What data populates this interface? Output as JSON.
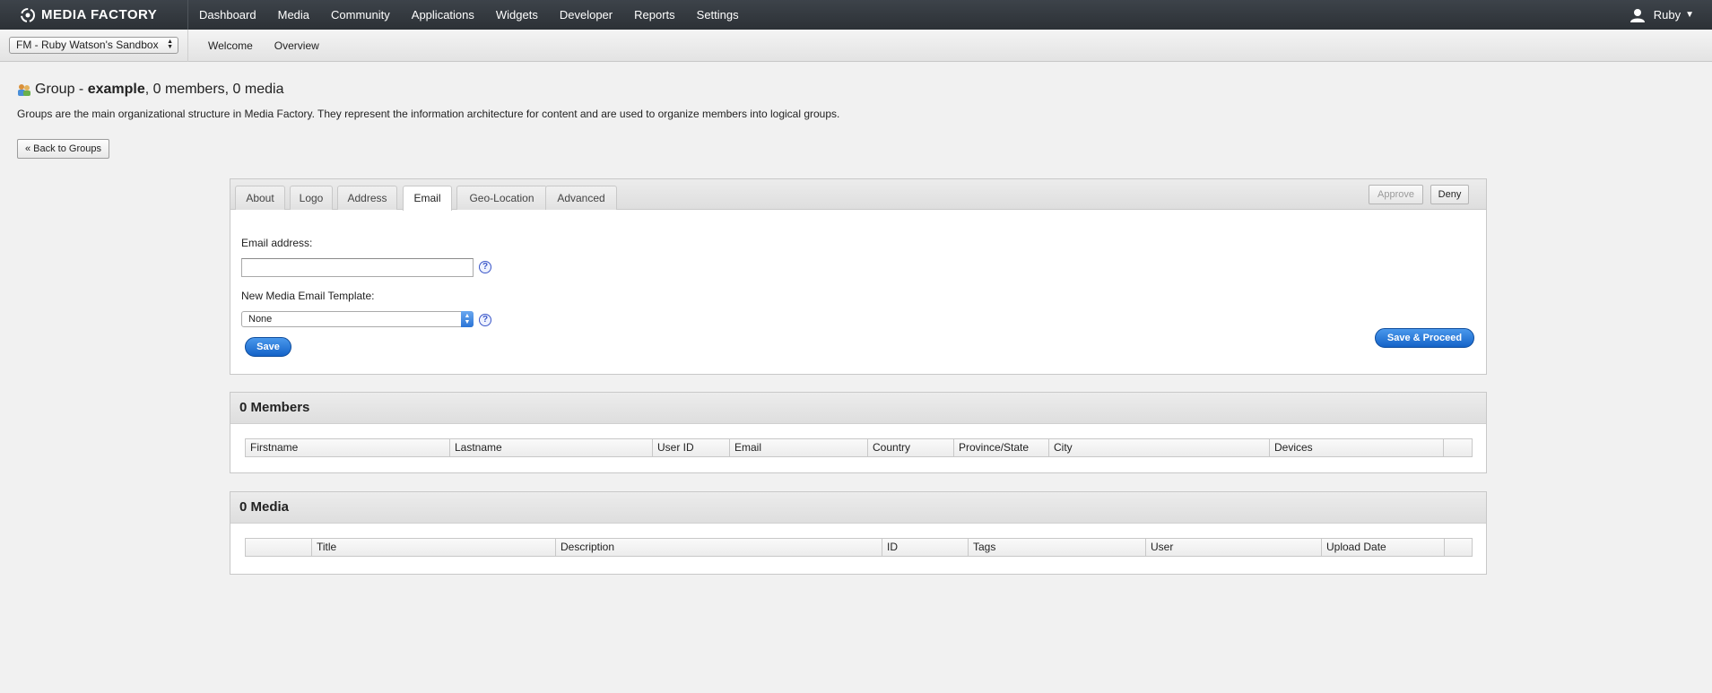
{
  "topbar": {
    "logo": "MEDIA FACTORY",
    "nav": [
      "Dashboard",
      "Media",
      "Community",
      "Applications",
      "Widgets",
      "Developer",
      "Reports",
      "Settings"
    ],
    "user": "Ruby"
  },
  "subbar": {
    "sandbox": "FM - Ruby Watson's Sandbox",
    "links": [
      "Welcome",
      "Overview"
    ]
  },
  "page": {
    "title_prefix": "Group - ",
    "title_name": "example",
    "title_suffix": ", 0 members, 0 media",
    "description": "Groups are the main organizational structure in Media Factory. They represent the information architecture for content and are used to organize members into logical groups.",
    "back_button": "« Back to Groups"
  },
  "tabs": {
    "items": [
      "About",
      "Logo",
      "Address",
      "Email",
      "Geo-Location",
      "Advanced"
    ],
    "active": "Email",
    "approve": "Approve",
    "deny": "Deny"
  },
  "email_form": {
    "email_label": "Email address:",
    "email_value": "",
    "template_label": "New Media Email Template:",
    "template_value": "None",
    "save": "Save",
    "save_proceed": "Save & Proceed",
    "help": "?"
  },
  "members": {
    "title": "0 Members",
    "columns": [
      "Firstname",
      "Lastname",
      "User ID",
      "Email",
      "Country",
      "Province/State",
      "City",
      "Devices",
      ""
    ]
  },
  "media": {
    "title": "0 Media",
    "columns": [
      "",
      "Title",
      "Description",
      "ID",
      "Tags",
      "User",
      "Upload Date",
      ""
    ]
  },
  "colors": {
    "topbar": "#33383d",
    "accent_blue": "#1463c8",
    "help_blue": "#3a56c8"
  }
}
